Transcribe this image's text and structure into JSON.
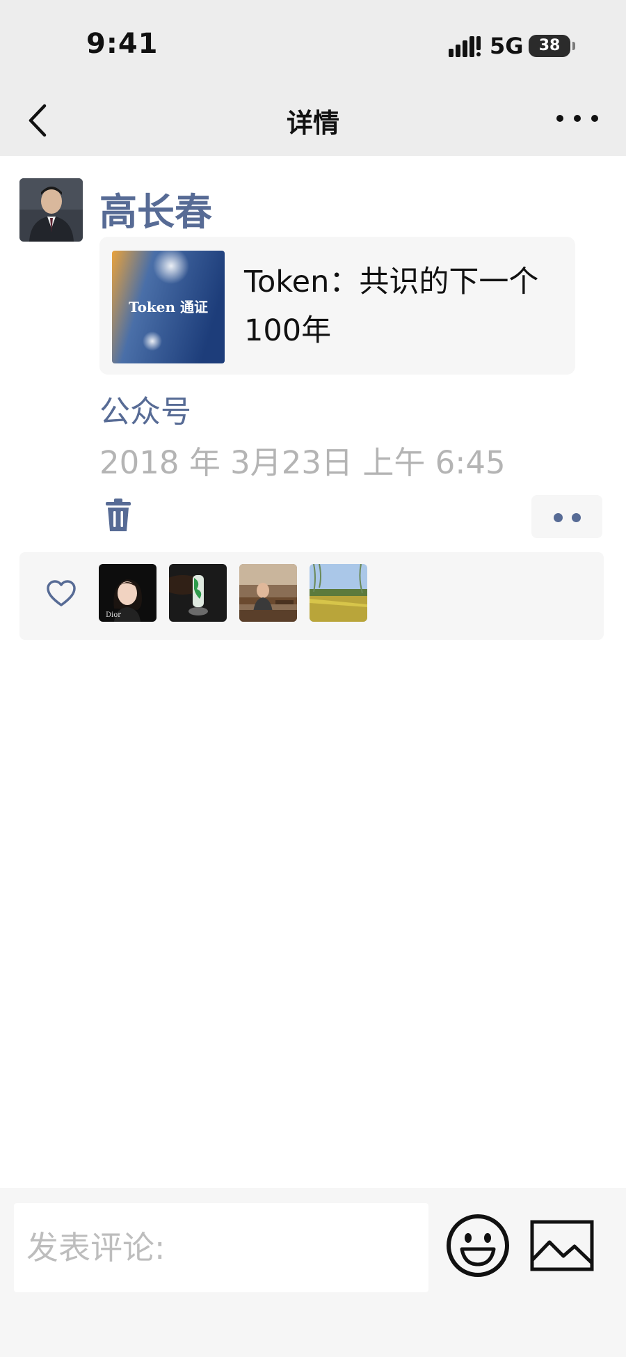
{
  "status_bar": {
    "time": "9:41",
    "network": "5G",
    "battery": "38"
  },
  "nav": {
    "title": "详情"
  },
  "post": {
    "author": "高长春",
    "link": {
      "title": "Token：共识的下一个100年",
      "thumbnail_text": "Token 通证"
    },
    "source": "公众号",
    "timestamp": "2018 年 3月23日 上午 6:45"
  },
  "likes": {
    "count": 4,
    "avatars": [
      "liker-avatar-1",
      "liker-avatar-2",
      "liker-avatar-3",
      "liker-avatar-4"
    ],
    "avatar_caption_1": "Dior"
  },
  "comment_bar": {
    "placeholder": "发表评论:"
  },
  "colors": {
    "nav_bg": "#ededed",
    "link_blue": "#576b95",
    "meta_gray": "#b4b4b4",
    "card_bg": "#f6f6f6"
  },
  "icons": {
    "back": "chevron-left-icon",
    "more": "more-horizontal-icon",
    "delete": "trash-icon",
    "like": "heart-icon",
    "emoji": "smiley-icon",
    "image": "image-icon"
  }
}
